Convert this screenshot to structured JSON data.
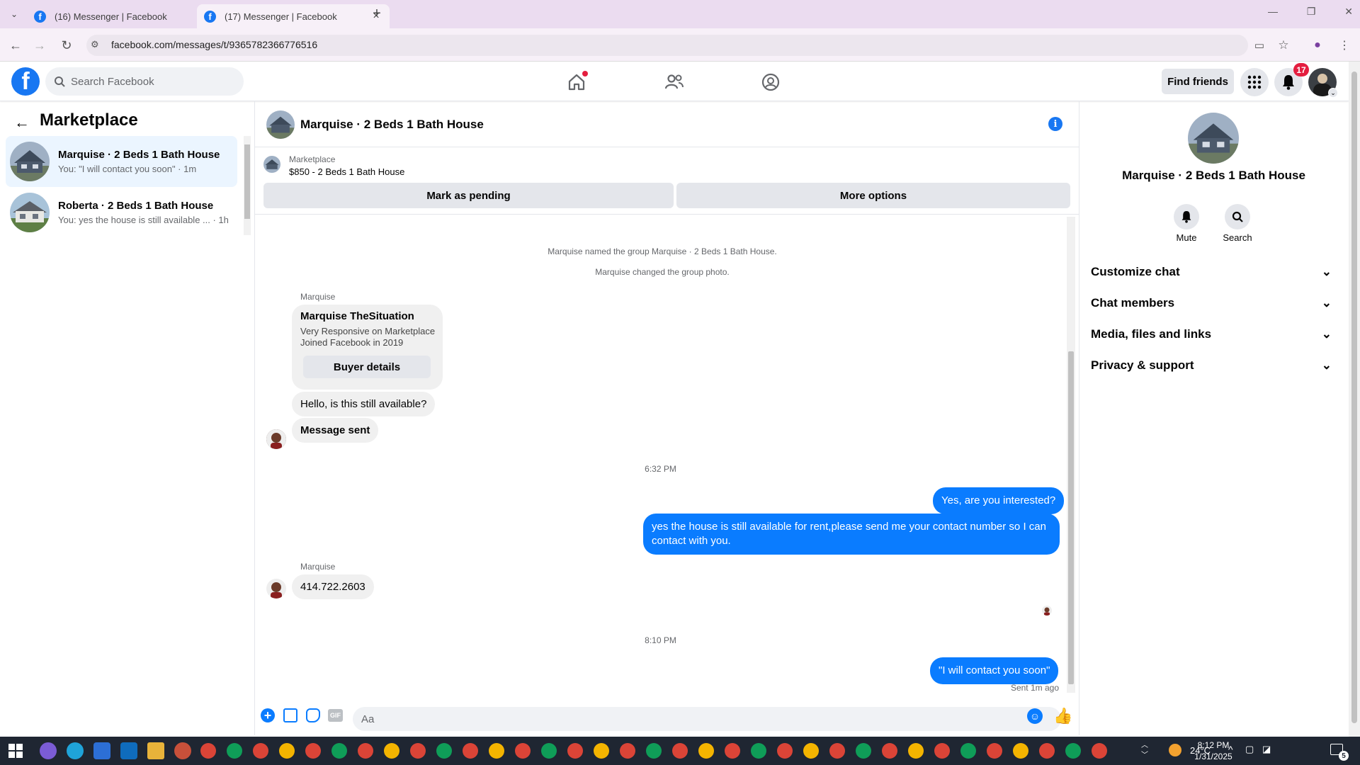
{
  "browser": {
    "tabs": [
      {
        "title": "(16) Messenger | Facebook"
      },
      {
        "title": "(17) Messenger | Facebook"
      }
    ],
    "url": "facebook.com/messages/t/9365782366776516"
  },
  "header": {
    "search_placeholder": "Search Facebook",
    "find_friends": "Find friends",
    "notification_count": "17"
  },
  "sidebar": {
    "title": "Marketplace",
    "conversations": [
      {
        "name": "Marquise · 2 Beds 1 Bath House",
        "preview": "You: \"I will contact you soon\" · 1m"
      },
      {
        "name": "Roberta · 2 Beds 1 Bath House",
        "preview": "You: yes the house is still available ... · 1h"
      }
    ]
  },
  "chat": {
    "title": "Marquise · 2 Beds 1 Bath House",
    "listing_source": "Marketplace",
    "listing_price_title": "$850 - 2 Beds 1 Bath House",
    "mark_pending": "Mark as pending",
    "more_options": "More options",
    "system_messages": [
      "Marquise named the group Marquise · 2 Beds 1 Bath House.",
      "Marquise changed the group photo."
    ],
    "buyer_card": {
      "sender": "Marquise",
      "name": "Marquise TheSituation",
      "line1": "Very Responsive on Marketplace",
      "line2": "Joined Facebook in 2019",
      "button": "Buyer details"
    },
    "incoming_1": "Hello, is this still available?",
    "incoming_2": "Message sent",
    "time_1": "6:32 PM",
    "outgoing_1": "Yes, are you interested?",
    "outgoing_2": "yes the house is still available for rent,please send me your contact number so I can contact with you.",
    "sender_2": "Marquise",
    "incoming_3": "414.722.2603",
    "time_2": "8:10 PM",
    "outgoing_3": "\"I will contact you soon\"",
    "status": "Sent 1m ago",
    "composer_placeholder": "Aa"
  },
  "info_panel": {
    "title": "Marquise · 2 Beds 1 Bath House",
    "mute": "Mute",
    "search": "Search",
    "sections": [
      "Customize chat",
      "Chat members",
      "Media, files and links",
      "Privacy & support"
    ]
  },
  "taskbar": {
    "weather": "24°C",
    "time": "8:12 PM",
    "date": "1/31/2025",
    "notif": "5"
  },
  "colors": {
    "fb_blue": "#1877f2",
    "bubble_out": "#0a7cff",
    "bubble_in": "#f0f0f0"
  }
}
